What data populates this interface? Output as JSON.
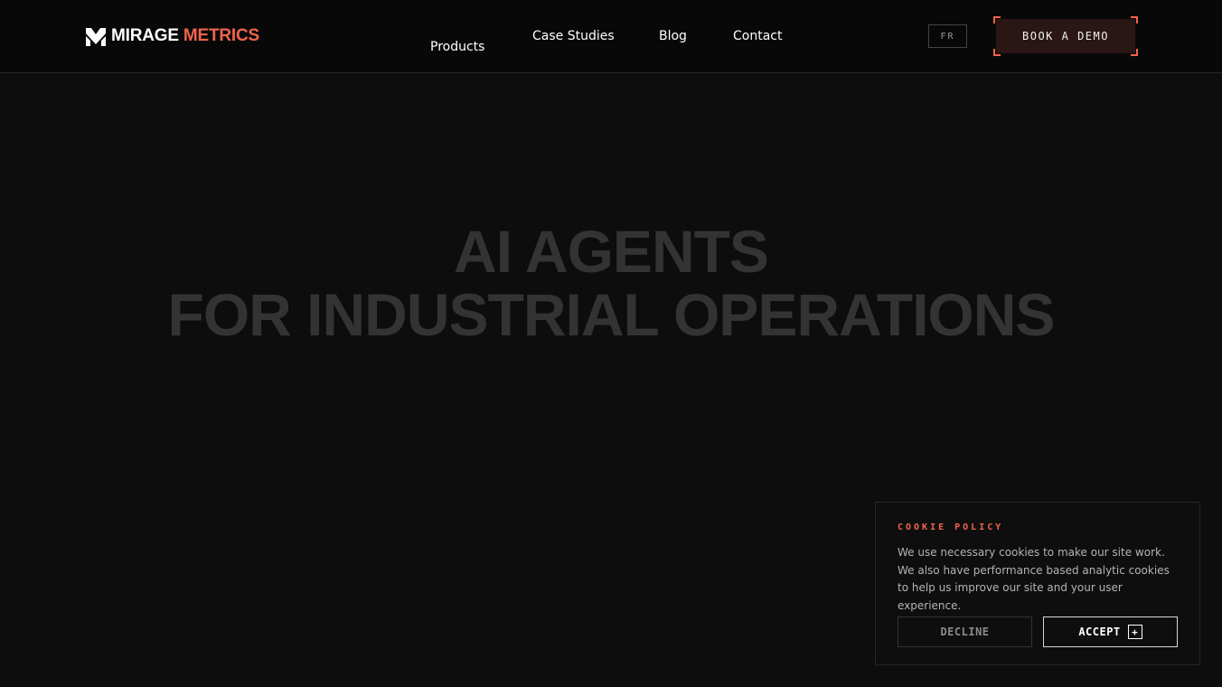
{
  "header": {
    "logo": {
      "word1": "MIRAGE",
      "word2": "METRICS",
      "icon": "mirage-m-logo-icon"
    },
    "nav": {
      "products": "Products",
      "case_studies": "Case Studies",
      "blog": "Blog",
      "contact": "Contact"
    },
    "language": "FR",
    "cta": "BOOK A DEMO"
  },
  "hero": {
    "line1": "AI AGENTS",
    "line2": "FOR INDUSTRIAL OPERATIONS"
  },
  "cookie_banner": {
    "title": "COOKIE POLICY",
    "text": "We use necessary cookies to make our site work. We also have performance based analytic cookies to help us improve our site and your user experience.",
    "decline": "DECLINE",
    "accept": "ACCEPT",
    "accept_icon": "plus-icon"
  },
  "colors": {
    "background": "#0d0d0d",
    "accent": "#f0644c",
    "cta_background": "#2a1614",
    "hero_text": "#333333"
  }
}
